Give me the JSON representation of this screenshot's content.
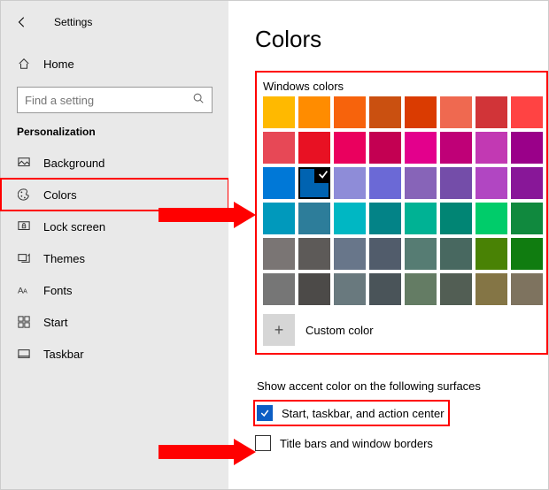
{
  "app_title": "Settings",
  "home_label": "Home",
  "search": {
    "placeholder": "Find a setting"
  },
  "category": "Personalization",
  "nav": {
    "background": "Background",
    "colors": "Colors",
    "lockscreen": "Lock screen",
    "themes": "Themes",
    "fonts": "Fonts",
    "start": "Start",
    "taskbar": "Taskbar"
  },
  "page_heading": "Colors",
  "windows_colors_label": "Windows colors",
  "custom_color_label": "Custom color",
  "accent_surfaces_heading": "Show accent color on the following surfaces",
  "opt_start": "Start, taskbar, and action center",
  "opt_title": "Title bars and window borders",
  "selected_color_index": 17,
  "colors": [
    "#FFB900",
    "#FF8C00",
    "#F7630C",
    "#CA5010",
    "#DA3B01",
    "#EF6950",
    "#D13438",
    "#FF4343",
    "#E74856",
    "#E81123",
    "#EA005E",
    "#C30052",
    "#E3008C",
    "#BF0077",
    "#C239B3",
    "#9A0089",
    "#0078D7",
    "#0063B1",
    "#8E8CD8",
    "#6B69D6",
    "#8764B8",
    "#744DA9",
    "#B146C2",
    "#881798",
    "#0099BC",
    "#2D7D9A",
    "#00B7C3",
    "#038387",
    "#00B294",
    "#018574",
    "#00CC6A",
    "#10893E",
    "#7A7574",
    "#5D5A58",
    "#68768A",
    "#515C6B",
    "#567C73",
    "#486860",
    "#498205",
    "#107C10",
    "#767676",
    "#4C4A48",
    "#69797E",
    "#4A5459",
    "#647C64",
    "#525E54",
    "#847545",
    "#7E735F"
  ]
}
